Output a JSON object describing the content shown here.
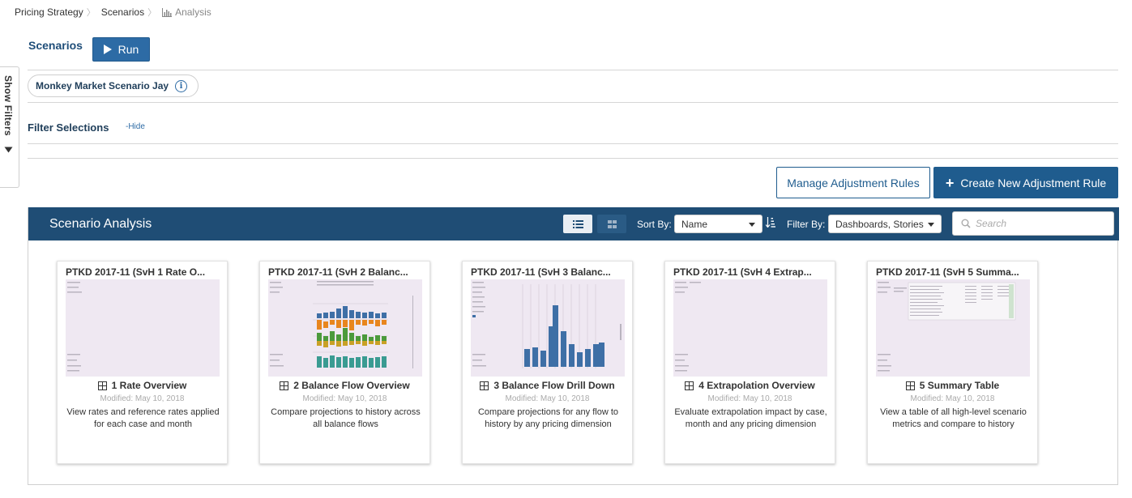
{
  "breadcrumb": {
    "items": [
      "Pricing Strategy",
      "Scenarios"
    ],
    "current": "Analysis",
    "current_icon": "bar-chart-icon"
  },
  "side_tab": {
    "label": "Show Filters",
    "icon": "caret-down-icon"
  },
  "scenarios": {
    "title": "Scenarios",
    "run_label": "Run"
  },
  "scenario_pill": {
    "name": "Monkey Market Scenario Jay",
    "icon": "info-icon"
  },
  "filter_selections": {
    "title": "Filter Selections",
    "hide_label": "-Hide"
  },
  "actions": {
    "manage_label": "Manage Adjustment Rules",
    "create_label": "Create New Adjustment Rule"
  },
  "panel": {
    "title": "Scenario Analysis",
    "sort_label": "Sort By:",
    "sort_value": "Name",
    "filter_label": "Filter By:",
    "filter_value": "Dashboards, Stories",
    "search_placeholder": "Search",
    "colors": {
      "header": "#1f4d75",
      "accent": "#2d6ba5"
    }
  },
  "cards": [
    {
      "title": "PTKD 2017-11 (SvH 1 Rate O...",
      "name": "1 Rate Overview",
      "modified": "Modified: May 10, 2018",
      "description": "View rates and reference rates applied for each case and month"
    },
    {
      "title": "PTKD 2017-11 (SvH 2 Balanc...",
      "name": "2 Balance Flow Overview",
      "modified": "Modified: May 10, 2018",
      "description": "Compare projections to history across all balance flows"
    },
    {
      "title": "PTKD 2017-11 (SvH 3 Balanc...",
      "name": "3 Balance Flow Drill Down",
      "modified": "Modified: May 10, 2018",
      "description": "Compare projections for any flow to history by any pricing dimension"
    },
    {
      "title": "PTKD 2017-11 (SvH 4 Extrap...",
      "name": "4 Extrapolation Overview",
      "modified": "Modified: May 10, 2018",
      "description": "Evaluate extrapolation impact by case, month and any pricing dimension"
    },
    {
      "title": "PTKD 2017-11 (SvH 5 Summa...",
      "name": "5 Summary Table",
      "modified": "Modified: May 10, 2018",
      "description": "View a table of all high-level scenario metrics and compare to history"
    }
  ]
}
